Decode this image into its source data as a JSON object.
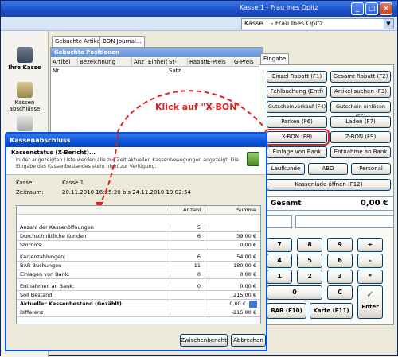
{
  "window": {
    "title": "Kasse 1 - Frau Ines Opitz"
  },
  "header": {
    "user_select": "Kasse 1 - Frau Ines Opitz"
  },
  "sidebar": {
    "items": [
      {
        "label": "Ihre Kasse"
      },
      {
        "label": "Kassen abschlüsse"
      },
      {
        "label": ""
      }
    ]
  },
  "tabs": [
    {
      "label": "Gebuchte Artikel..."
    },
    {
      "label": "BON Journal..."
    }
  ],
  "positions": {
    "title": "Gebuchte Positionen",
    "columns": [
      "Artikel Nr",
      "Bezeichnung",
      "Anz",
      "Einheit",
      "St-Satz",
      "Rabatt",
      "E-Preis",
      "G-Preis"
    ]
  },
  "eingabe": {
    "tab": "Eingabe",
    "buttons": [
      "Einzel Rabatt (F1)",
      "Gesamt Rabatt (F2)",
      "Fehlbuchung (Entf)",
      "Artikel suchen (F3)",
      "Gutscheinverkauf (F4)",
      "Gutschein einlösen (F5)",
      "Parken (F6)",
      "Laden (F7)",
      "X-BON (F8)",
      "Z-BON (F9)",
      "Einlage von Bank",
      "Entnahme an Bank",
      "Laufkunde",
      "ABO",
      "Personal",
      "Kassenlade öffnen (F12)"
    ],
    "gesamt_label": "Gesamt",
    "gesamt_value": "0,00 €",
    "keys": [
      "7",
      "8",
      "9",
      "+",
      "4",
      "5",
      "6",
      "-",
      "1",
      "2",
      "3",
      "*",
      "0",
      "C"
    ],
    "bar_label": "BAR (F10)",
    "karte_label": "Karte (F11)",
    "enter_label": "Enter"
  },
  "annotation": "Klick auf \"X-BON\"",
  "dialog": {
    "title": "Kassenabschluss",
    "heading": "Kassenstatus (X-Bericht)...",
    "description": "In der angezeigten Liste werden alle zur Zeit aktuellen Kassenbewegungen angezeigt. Die Eingabe des Kassenbestandes steht nicht zur Verfügung.",
    "kasse_label": "Kasse:",
    "kasse_value": "Kasse 1",
    "zeitraum_label": "Zeitraum:",
    "zeitraum_value": "20.11.2010 16:25:20 bis 24.11.2010 19:02:54",
    "col_anzahl": "Anzahl",
    "col_summe": "Summe",
    "rows": [
      {
        "label": "Anzahl der Kassenöffnungen",
        "anzahl": "5",
        "summe": ""
      },
      {
        "label": "Durchschnittliche Kunden",
        "anzahl": "6",
        "summe": "39,00 €"
      },
      {
        "label": "Storno's:",
        "anzahl": "",
        "summe": "0,00 €"
      },
      {
        "label": "Kartenzahlungen:",
        "anzahl": "6",
        "summe": "54,00 €"
      },
      {
        "label": "BAR Buchungen",
        "anzahl": "11",
        "summe": "180,00 €"
      },
      {
        "label": "Einlagen von Bank:",
        "anzahl": "0",
        "summe": "0,00 €"
      },
      {
        "label": "Entnahmen an Bank:",
        "anzahl": "0",
        "summe": "0,00 €"
      },
      {
        "label": "Soll Bestand:",
        "anzahl": "",
        "summe": "215,00 €"
      },
      {
        "label": "Aktueller Kassenbestand (Gezählt)",
        "anzahl": "",
        "summe": "0,00 €"
      },
      {
        "label": "Differenz",
        "anzahl": "",
        "summe": "-215,00 €"
      }
    ],
    "btn_zwischen": "Zwischenbericht",
    "btn_abbrechen": "Abbrechen"
  }
}
